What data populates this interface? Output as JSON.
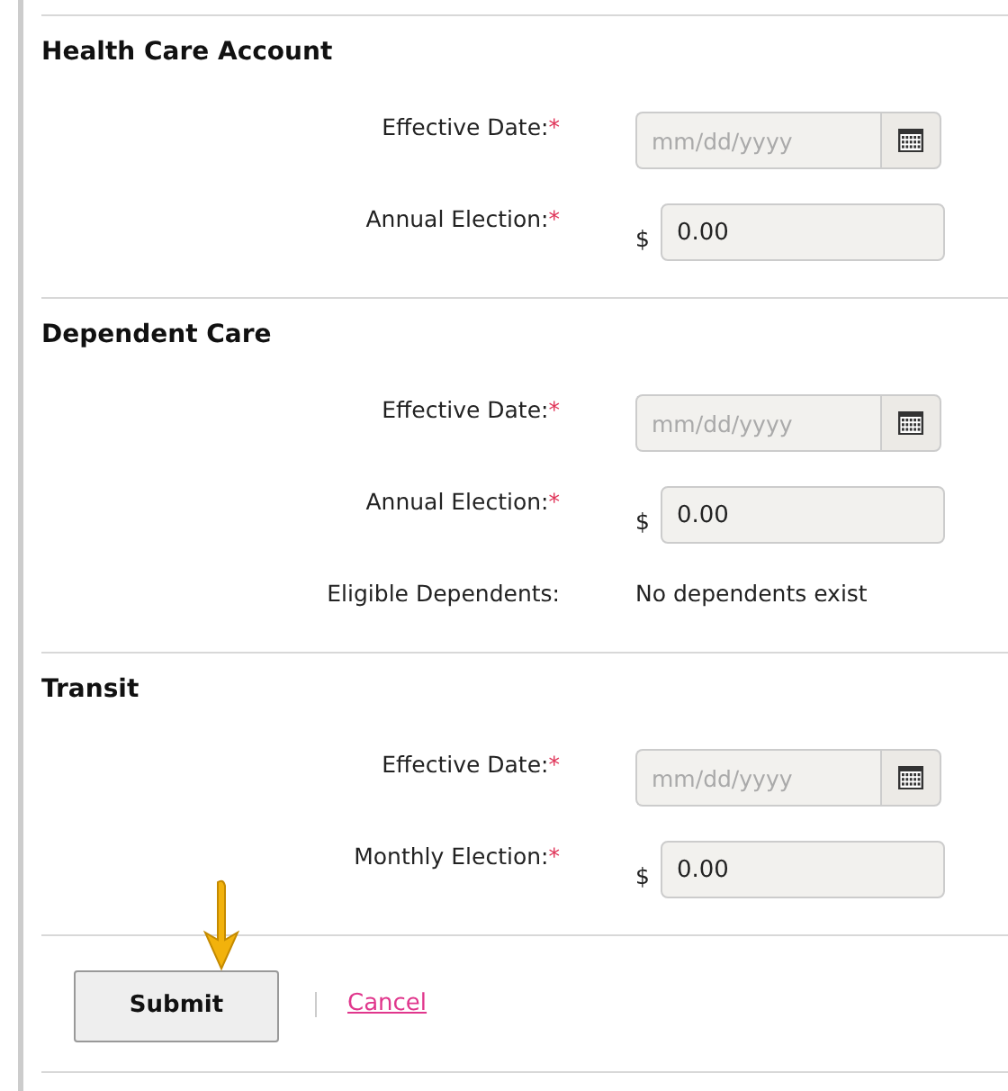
{
  "sections": [
    {
      "title": "Health Care Account",
      "fields": [
        {
          "kind": "date",
          "label": "Effective Date:",
          "required_mark": "*",
          "placeholder": "mm/dd/yyyy"
        },
        {
          "kind": "amount",
          "label": "Annual Election:",
          "required_mark": "*",
          "currency": "$",
          "value": "0.00"
        }
      ]
    },
    {
      "title": "Dependent Care",
      "fields": [
        {
          "kind": "date",
          "label": "Effective Date:",
          "required_mark": "*",
          "placeholder": "mm/dd/yyyy"
        },
        {
          "kind": "amount",
          "label": "Annual Election:",
          "required_mark": "*",
          "currency": "$",
          "value": "0.00"
        },
        {
          "kind": "text",
          "label": "Eligible Dependents:",
          "value": "No dependents exist"
        }
      ]
    },
    {
      "title": "Transit",
      "fields": [
        {
          "kind": "date",
          "label": "Effective Date:",
          "required_mark": "*",
          "placeholder": "mm/dd/yyyy"
        },
        {
          "kind": "amount",
          "label": "Monthly Election:",
          "required_mark": "*",
          "currency": "$",
          "value": "0.00"
        }
      ]
    }
  ],
  "actions": {
    "submit": "Submit",
    "cancel": "Cancel"
  }
}
